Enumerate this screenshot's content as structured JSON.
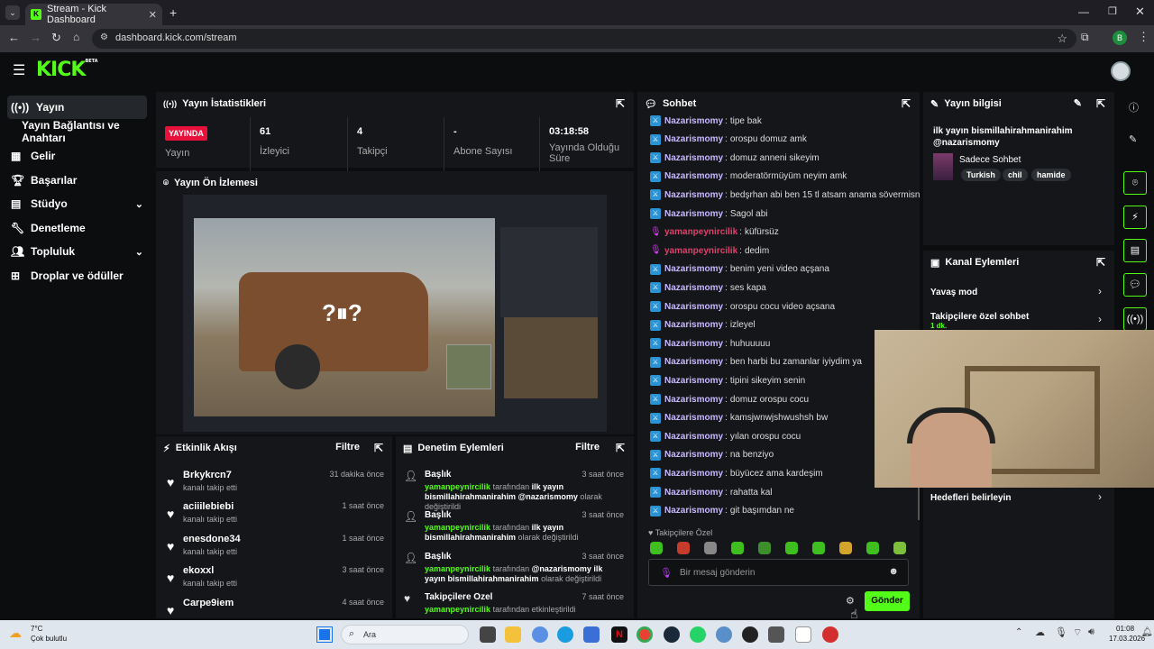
{
  "browser": {
    "tab_title": "Stream - Kick Dashboard",
    "url": "dashboard.kick.com/stream",
    "profile_initial": "B"
  },
  "app": {
    "logo": "KICK",
    "logo_sup": "BETA"
  },
  "sidebar": {
    "items": [
      {
        "label": "Yayın",
        "icon": "broadcast-icon"
      },
      {
        "label": "Yayın Bağlantısı ve Anahtarı",
        "icon": ""
      },
      {
        "label": "Gelir",
        "icon": "revenue-icon"
      },
      {
        "label": "Başarılar",
        "icon": "trophy-icon"
      },
      {
        "label": "Stüdyo",
        "icon": "studio-icon"
      },
      {
        "label": "Denetleme",
        "icon": "wrench-icon"
      },
      {
        "label": "Topluluk",
        "icon": "community-icon"
      },
      {
        "label": "Droplar ve ödüller",
        "icon": "gift-icon"
      }
    ]
  },
  "stats": {
    "title": "Yayın İstatistikleri",
    "status_badge": "YAYINDA",
    "status_label": "Yayın",
    "viewers_value": "61",
    "viewers_label": "İzleyici",
    "followers_value": "4",
    "followers_label": "Takipçi",
    "subs_value": "-",
    "subs_label": "Abone Sayısı",
    "uptime_value": "03:18:58",
    "uptime_label": "Yayında Olduğu Süre"
  },
  "preview": {
    "title": "Yayın Ön İzlemesi"
  },
  "activity": {
    "title": "Etkinlik Akışı",
    "filter": "Filtre",
    "events": [
      {
        "user": "Brkykrcn7",
        "action": "kanalı takip etti",
        "time": "31 dakika önce"
      },
      {
        "user": "aciiilebiebi",
        "action": "kanalı takip etti",
        "time": "1 saat önce"
      },
      {
        "user": "enesdone34",
        "action": "kanalı takip etti",
        "time": "1 saat önce"
      },
      {
        "user": "ekoxxl",
        "action": "kanalı takip etti",
        "time": "3 saat önce"
      },
      {
        "user": "Carpe9iem",
        "action": "",
        "time": "4 saat önce"
      }
    ]
  },
  "moderation": {
    "title": "Denetim Eylemleri",
    "filter": "Filtre",
    "items": [
      {
        "head": "Başlık",
        "actor": "yamanpeynircilik",
        "by": "tarafından",
        "text": "ilk yayın bismillahirahmanirahim @nazarismomy",
        "suffix": "olarak değiştirildi",
        "time": "3 saat önce"
      },
      {
        "head": "Başlık",
        "actor": "yamanpeynircilik",
        "by": "tarafından",
        "text": "ilk yayın bismillahirahmanirahim",
        "suffix": "olarak değiştirildi",
        "time": "3 saat önce"
      },
      {
        "head": "Başlık",
        "actor": "yamanpeynircilik",
        "by": "tarafından",
        "text": "@nazarismomy ilk yayın bismillahirahmanirahim",
        "suffix": "olarak değiştirildi",
        "time": "3 saat önce"
      },
      {
        "head": "Takipçilere Özel",
        "actor": "yamanpeynircilik",
        "by": "tarafından etkinleştirildi",
        "text": "",
        "suffix": "",
        "time": "7 saat önce"
      }
    ]
  },
  "chat": {
    "title": "Sohbet",
    "messages": [
      {
        "user": "Nazarismomy",
        "text": "tipe bak",
        "kind": "mod"
      },
      {
        "user": "Nazarismomy",
        "text": "orospu domuz amk",
        "kind": "mod"
      },
      {
        "user": "Nazarismomy",
        "text": "domuz anneni sikeyim",
        "kind": "mod"
      },
      {
        "user": "Nazarismomy",
        "text": "moderatörmüyüm neyim amk",
        "kind": "mod"
      },
      {
        "user": "Nazarismomy",
        "text": "bedşrhan abi ben 15 tl atsam anama sövermisn",
        "kind": "mod"
      },
      {
        "user": "Nazarismomy",
        "text": "Sagol abi",
        "kind": "mod"
      },
      {
        "user": "yamanpeynircilik",
        "text": "küfürsüz",
        "kind": "owner"
      },
      {
        "user": "yamanpeynircilik",
        "text": "dedim",
        "kind": "owner"
      },
      {
        "user": "Nazarismomy",
        "text": "benim yeni video açşana",
        "kind": "mod"
      },
      {
        "user": "Nazarismomy",
        "text": "ses kapa",
        "kind": "mod"
      },
      {
        "user": "Nazarismomy",
        "text": "orospu cocu video açsana",
        "kind": "mod"
      },
      {
        "user": "Nazarismomy",
        "text": "izleyel",
        "kind": "mod"
      },
      {
        "user": "Nazarismomy",
        "text": "huhuuuuu",
        "kind": "mod"
      },
      {
        "user": "Nazarismomy",
        "text": "ben harbi bu zamanlar iyiydim ya",
        "kind": "mod"
      },
      {
        "user": "Nazarismomy",
        "text": "tipini sikeyim senin",
        "kind": "mod"
      },
      {
        "user": "Nazarismomy",
        "text": "domuz orospu cocu",
        "kind": "mod"
      },
      {
        "user": "Nazarismomy",
        "text": "kamsjwnwjshwushsh bw",
        "kind": "mod"
      },
      {
        "user": "Nazarismomy",
        "text": "yılan orospu cocu",
        "kind": "mod"
      },
      {
        "user": "Nazarismomy",
        "text": "na benziyo",
        "kind": "mod"
      },
      {
        "user": "Nazarismomy",
        "text": "büyücez ama kardeşim",
        "kind": "mod"
      },
      {
        "user": "Nazarismomy",
        "text": "rahatta kal",
        "kind": "mod"
      },
      {
        "user": "Nazarismomy",
        "text": "git başımdan ne",
        "kind": "mod"
      }
    ],
    "followers_only_label": "Takipçilere Özel",
    "input_placeholder": "Bir mesaj gönderin",
    "send_label": "Gönder"
  },
  "stream_info": {
    "title": "Yayın bilgisi",
    "stream_title": "ilk yayın bismillahirahmanirahim @nazarismomy",
    "category": "Sadece Sohbet",
    "tags": [
      "Turkish",
      "chil",
      "hamide"
    ]
  },
  "channel_actions": {
    "title": "Kanal Eylemleri",
    "slow_mode": "Yavaş mod",
    "followers_only": "Takipçilere özel sohbet",
    "followers_only_sub": "1 dk.",
    "goals": "Hedefleri belirleyin"
  },
  "taskbar": {
    "weather_temp": "7°C",
    "weather_desc": "Çok bulutlu",
    "search_label": "Ara",
    "time": "01:08",
    "date": "17.03.2026"
  },
  "colors": {
    "accent": "#53fc18",
    "badge": "#e9113c"
  }
}
